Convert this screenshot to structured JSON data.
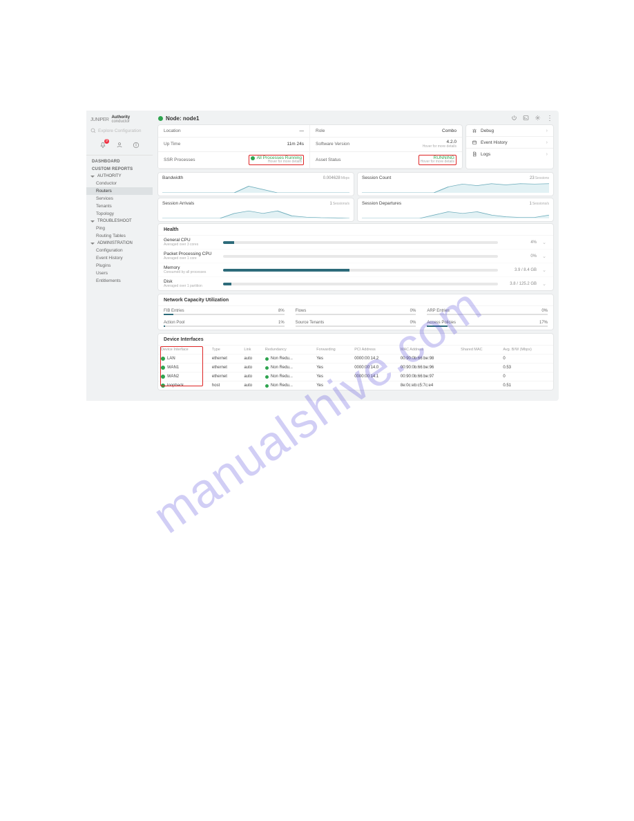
{
  "brand": {
    "logo": "JUNIPER",
    "title": "Authority",
    "subtitle": "conductor"
  },
  "search": {
    "placeholder": "Explore Configuration"
  },
  "notif_badge": "9",
  "nav": {
    "dashboard": "DASHBOARD",
    "custom_reports": "CUSTOM REPORTS",
    "groups": [
      {
        "title": "AUTHORITY",
        "items": [
          "Conductor",
          "Routers",
          "Services",
          "Tenants",
          "Topology"
        ],
        "active_index": 1
      },
      {
        "title": "TROUBLESHOOT",
        "items": [
          "Ping",
          "Routing Tables"
        ]
      },
      {
        "title": "ADMINISTRATION",
        "items": [
          "Configuration",
          "Event History",
          "Plugins",
          "Users",
          "Entitlements"
        ]
      }
    ]
  },
  "page": {
    "title_prefix": "Node:",
    "title_name": "node1",
    "info": {
      "location_label": "Location",
      "location_value": "—",
      "role_label": "Role",
      "role_value": "Combo",
      "uptime_label": "Up Time",
      "uptime_value": "11m 24s",
      "swver_label": "Software Version",
      "swver_value": "4.2.0",
      "swver_sub": "Hover for more details",
      "proc_label": "SSR Processes",
      "proc_value": "All Processes Running",
      "proc_sub": "Hover for more details",
      "asset_label": "Asset Status",
      "asset_value": "RUNNING",
      "asset_sub": "Hover for more details"
    },
    "actions": [
      {
        "icon": "bug",
        "label": "Debug"
      },
      {
        "icon": "calendar",
        "label": "Event History"
      },
      {
        "icon": "doc",
        "label": "Logs"
      }
    ]
  },
  "charts": [
    {
      "title": "Bandwidth",
      "value": "0.004628",
      "unit": "Mbps"
    },
    {
      "title": "Session Count",
      "value": "23",
      "unit": "Sessions"
    },
    {
      "title": "Session Arrivals",
      "value": "1",
      "unit": "Sessions/s"
    },
    {
      "title": "Session Departures",
      "value": "1",
      "unit": "Sessions/s"
    }
  ],
  "chart_data": [
    {
      "type": "line",
      "title": "Bandwidth",
      "ylabel": "Mbps",
      "x": [
        0,
        1,
        2,
        3,
        4,
        5,
        6,
        7,
        8,
        9,
        10,
        11,
        12,
        13
      ],
      "values": [
        0,
        0,
        0,
        0,
        0,
        0,
        0.02,
        0.01,
        0,
        0,
        0,
        0,
        0,
        0
      ],
      "ylim": [
        0,
        0.03
      ]
    },
    {
      "type": "line",
      "title": "Session Count",
      "ylabel": "Sessions",
      "x": [
        0,
        1,
        2,
        3,
        4,
        5,
        6,
        7,
        8,
        9,
        10,
        11,
        12,
        13
      ],
      "values": [
        0,
        0,
        0,
        0,
        0,
        0,
        15,
        22,
        18,
        23,
        20,
        23,
        22,
        23
      ],
      "ylim": [
        0,
        25
      ]
    },
    {
      "type": "line",
      "title": "Session Arrivals",
      "ylabel": "Sessions/s",
      "x": [
        0,
        1,
        2,
        3,
        4,
        5,
        6,
        7,
        8,
        9,
        10,
        11,
        12,
        13
      ],
      "values": [
        0,
        0,
        0,
        0,
        0,
        2,
        3,
        2,
        3,
        1,
        0.5,
        0.3,
        0.2,
        0
      ],
      "ylim": [
        0,
        4
      ]
    },
    {
      "type": "line",
      "title": "Session Departures",
      "ylabel": "Sessions/s",
      "x": [
        0,
        1,
        2,
        3,
        4,
        5,
        6,
        7,
        8,
        9,
        10,
        11,
        12,
        13
      ],
      "values": [
        0,
        0,
        0,
        0,
        0,
        1,
        2,
        1.5,
        2,
        1,
        0.5,
        0.3,
        0.3,
        1
      ],
      "ylim": [
        0,
        3
      ]
    }
  ],
  "health": {
    "title": "Health",
    "metrics": [
      {
        "title": "General CPU",
        "sub": "Averaged over 3 cores",
        "pct": 4,
        "value": "4%"
      },
      {
        "title": "Packet Processing CPU",
        "sub": "Averaged over 1 core",
        "pct": 0,
        "value": "0%"
      },
      {
        "title": "Memory",
        "sub": "Consumed by all processes",
        "pct": 46,
        "value": "3.9 / 8.4 GB"
      },
      {
        "title": "Disk",
        "sub": "Averaged over 1 partition",
        "pct": 3,
        "value": "3.8 / 125.2 GB"
      }
    ]
  },
  "capacity": {
    "title": "Network Capacity Utilization",
    "items": [
      {
        "label": "FIB Entries",
        "pct": 8,
        "value": "8%"
      },
      {
        "label": "Flows",
        "pct": 0,
        "value": "0%"
      },
      {
        "label": "ARP Entries",
        "pct": 0,
        "value": "0%"
      },
      {
        "label": "Action Pool",
        "pct": 1,
        "value": "1%"
      },
      {
        "label": "Source Tenants",
        "pct": 0,
        "value": "0%"
      },
      {
        "label": "Access Policies",
        "pct": 17,
        "value": "17%"
      }
    ]
  },
  "interfaces": {
    "title": "Device Interfaces",
    "headers": [
      "Device Interface",
      "Type",
      "Link",
      "Redundancy",
      "Forwarding",
      "PCI Address",
      "MAC Address",
      "Shared MAC",
      "Avg. B/W (Mbps)"
    ],
    "rows": [
      {
        "name": "LAN",
        "type": "ethernet",
        "link": "auto",
        "redu": "Non Redu...",
        "fwd": "Yes",
        "pci": "0000:00:14.2",
        "mac": "00:90:0b:66:be:98",
        "smac": "",
        "bw": "0"
      },
      {
        "name": "WAN1",
        "type": "ethernet",
        "link": "auto",
        "redu": "Non Redu...",
        "fwd": "Yes",
        "pci": "0000:00:14.0",
        "mac": "00:90:0b:66:be:96",
        "smac": "",
        "bw": "0.53"
      },
      {
        "name": "WAN2",
        "type": "ethernet",
        "link": "auto",
        "redu": "Non Redu...",
        "fwd": "Yes",
        "pci": "0000:00:14.1",
        "mac": "00:90:0b:66:be:97",
        "smac": "",
        "bw": "0"
      },
      {
        "name": "loopback",
        "type": "host",
        "link": "auto",
        "redu": "Non Redu...",
        "fwd": "Yes",
        "pci": "",
        "mac": "8e:0c:eb:c5:7c:e4",
        "smac": "",
        "bw": "0.51"
      }
    ]
  },
  "watermark": "manualshive.com"
}
